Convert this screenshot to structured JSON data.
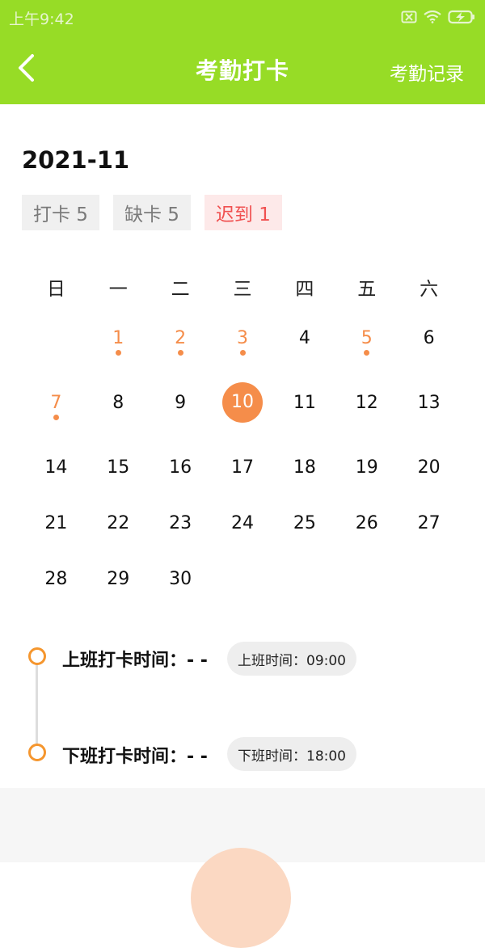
{
  "status_bar": {
    "time": "上午9:42"
  },
  "header": {
    "title": "考勤打卡",
    "record_link": "考勤记录",
    "accent": "#97dc26"
  },
  "month": "2021-11",
  "stats": [
    {
      "label": "打卡 5"
    },
    {
      "label": "缺卡 5"
    },
    {
      "label": "迟到 1"
    }
  ],
  "weekdays": [
    "日",
    "一",
    "二",
    "三",
    "四",
    "五",
    "六"
  ],
  "calendar": {
    "today": "10",
    "weeks": [
      [
        {
          "d": ""
        },
        {
          "d": "1",
          "mark": true
        },
        {
          "d": "2",
          "mark": true
        },
        {
          "d": "3",
          "mark": true
        },
        {
          "d": "4"
        },
        {
          "d": "5",
          "mark": true
        },
        {
          "d": "6"
        }
      ],
      [
        {
          "d": "7",
          "mark": true
        },
        {
          "d": "8"
        },
        {
          "d": "9"
        },
        {
          "d": "10",
          "today": true
        },
        {
          "d": "11"
        },
        {
          "d": "12"
        },
        {
          "d": "13"
        }
      ],
      [
        {
          "d": "14"
        },
        {
          "d": "15"
        },
        {
          "d": "16"
        },
        {
          "d": "17"
        },
        {
          "d": "18"
        },
        {
          "d": "19"
        },
        {
          "d": "20"
        }
      ],
      [
        {
          "d": "21"
        },
        {
          "d": "22"
        },
        {
          "d": "23"
        },
        {
          "d": "24"
        },
        {
          "d": "25"
        },
        {
          "d": "26"
        },
        {
          "d": "27"
        }
      ],
      [
        {
          "d": "28"
        },
        {
          "d": "29"
        },
        {
          "d": "30"
        },
        {
          "d": ""
        },
        {
          "d": ""
        },
        {
          "d": ""
        },
        {
          "d": ""
        }
      ]
    ]
  },
  "punch": {
    "clock_in": {
      "label": "上班打卡时间：- -",
      "scheduled": "上班时间：09:00"
    },
    "clock_out": {
      "label": "下班打卡时间：- -",
      "scheduled": "下班时间：18:00"
    }
  },
  "colors": {
    "orange": "#f58d4a",
    "late_red": "#f05050"
  }
}
